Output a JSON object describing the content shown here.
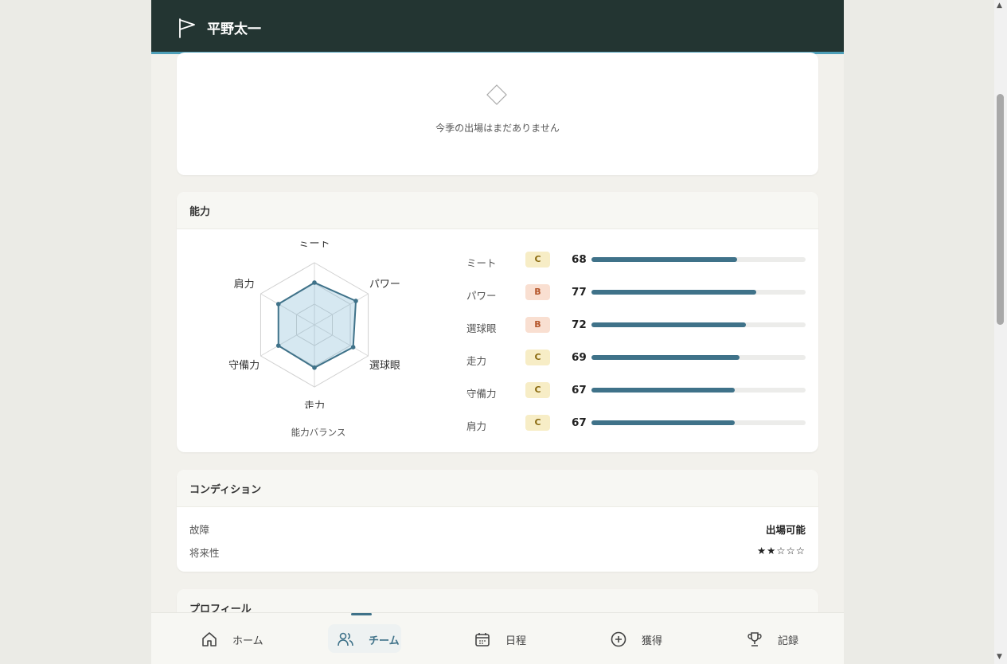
{
  "header": {
    "title": "平野太一",
    "icon": "flag-icon"
  },
  "season": {
    "icon": "diamond-icon",
    "empty_text": "今季の出場はまだありません"
  },
  "ability": {
    "title": "能力",
    "radar_caption": "能力バランス",
    "radar_labels": [
      "ミート",
      "パワー",
      "選球眼",
      "走力",
      "守備力",
      "肩力"
    ],
    "stats": [
      {
        "name": "ミート",
        "grade": "C",
        "value": 68
      },
      {
        "name": "パワー",
        "grade": "B",
        "value": 77
      },
      {
        "name": "選球眼",
        "grade": "B",
        "value": 72
      },
      {
        "name": "走力",
        "grade": "C",
        "value": 69
      },
      {
        "name": "守備力",
        "grade": "C",
        "value": 67
      },
      {
        "name": "肩力",
        "grade": "C",
        "value": 67
      }
    ],
    "max_value": 100
  },
  "condition": {
    "title": "コンディション",
    "rows": [
      {
        "label": "故障",
        "value": "出場可能"
      },
      {
        "label": "将来性",
        "value": "★★☆☆☆"
      }
    ]
  },
  "profile": {
    "title": "プロフィール"
  },
  "nav": [
    {
      "label": "ホーム",
      "icon": "home-icon"
    },
    {
      "label": "チーム",
      "icon": "team-icon",
      "active": true
    },
    {
      "label": "日程",
      "icon": "calendar-icon"
    },
    {
      "label": "獲得",
      "icon": "plus-circle-icon"
    },
    {
      "label": "記録",
      "icon": "trophy-icon"
    }
  ],
  "colors": {
    "header_bg": "#233532",
    "accent": "#3f7289",
    "grade_c_bg": "#f7edc6",
    "grade_c_fg": "#8a6a10",
    "grade_b_bg": "#f9dfd1",
    "grade_b_fg": "#b4552a"
  }
}
